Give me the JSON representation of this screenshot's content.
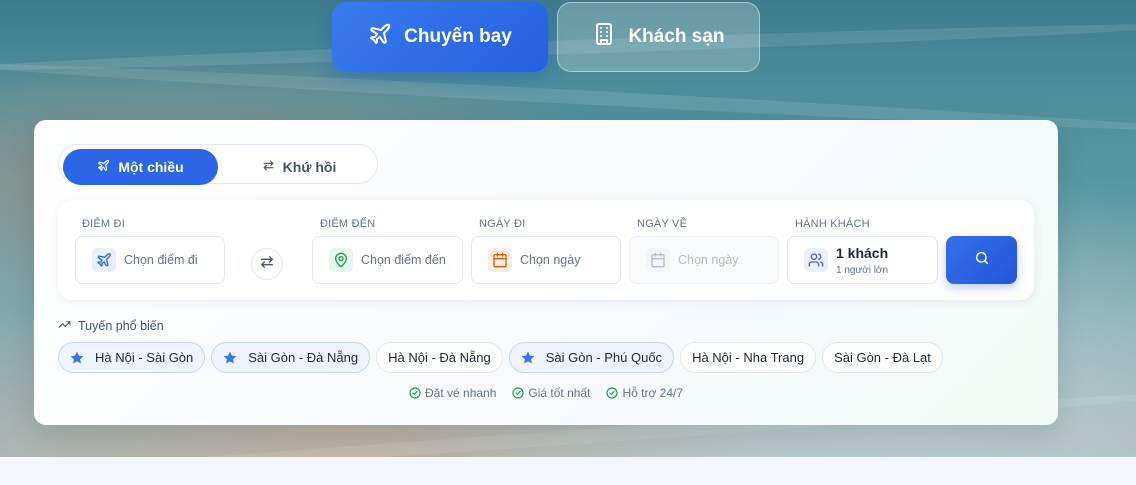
{
  "top_tabs": [
    {
      "label": "Chuyến bay",
      "icon": "plane-icon",
      "active": true
    },
    {
      "label": "Khách sạn",
      "icon": "building-icon",
      "active": false
    }
  ],
  "trip_type": {
    "one_way": "Một chiều",
    "round_trip": "Khứ hồi",
    "selected": "one_way"
  },
  "search": {
    "from": {
      "label": "ĐIỂM ĐI",
      "placeholder": "Chọn điểm đi",
      "icon": "plane-icon"
    },
    "swap_icon": "swap-arrows-icon",
    "to": {
      "label": "ĐIỂM ĐẾN",
      "placeholder": "Chọn điểm đến",
      "icon": "map-pin-icon"
    },
    "depart_date": {
      "label": "NGÀY ĐI",
      "placeholder": "Chọn ngày",
      "icon": "calendar-icon"
    },
    "return_date": {
      "label": "NGÀY VỀ",
      "placeholder": "Chọn ngày",
      "icon": "calendar-icon",
      "disabled": true
    },
    "passengers": {
      "label": "HÀNH KHÁCH",
      "value": "1 khách",
      "detail": "1 người lớn",
      "icon": "users-icon"
    },
    "submit_icon": "search-icon"
  },
  "popular": {
    "title": "Tuyến phổ biến",
    "routes": [
      {
        "label": "Hà Nội - Sài Gòn",
        "starred": true
      },
      {
        "label": "Sài Gòn - Đà Nẵng",
        "starred": true
      },
      {
        "label": "Hà Nội - Đà Nẵng",
        "starred": false
      },
      {
        "label": "Sài Gòn - Phú Quốc",
        "starred": true
      },
      {
        "label": "Hà Nội - Nha Trang",
        "starred": false
      },
      {
        "label": "Sài Gòn - Đà Lạt",
        "starred": false
      }
    ]
  },
  "features": [
    "Đặt vé nhanh",
    "Giá tốt nhất",
    "Hỗ trợ 24/7"
  ],
  "colors": {
    "primary": "#2b66e6",
    "green": "#16a34a",
    "orange": "#ea580c",
    "star": "#3b76e6"
  }
}
